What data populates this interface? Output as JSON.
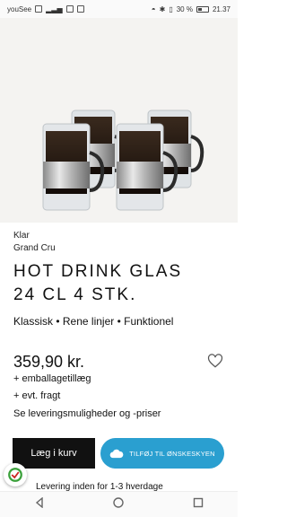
{
  "status_bar": {
    "carrier": "youSee",
    "battery_percent": "30 %",
    "time": "21.37"
  },
  "product": {
    "brand": "Klar",
    "collection": "Grand Cru",
    "title_line1": "HOT DRINK GLAS",
    "title_line2": "24 CL 4 STK.",
    "features": "Klassisk • Rene linjer • Funktionel",
    "price": "359,90 kr.",
    "extra_packaging": "+ emballagetillæg",
    "extra_shipping": "+ evt. fragt",
    "delivery_link": "Se leveringsmuligheder og -priser",
    "delivery_time": "Levering inden for 1-3 hverdage"
  },
  "buttons": {
    "add_to_cart": "Læg i kurv",
    "add_to_wishlist": "TILFØJ TIL ØNSKESKYEN"
  },
  "colors": {
    "wishlist_button": "#2a9fd0",
    "cart_button": "#111111",
    "hero_background": "#f4f3f1"
  }
}
